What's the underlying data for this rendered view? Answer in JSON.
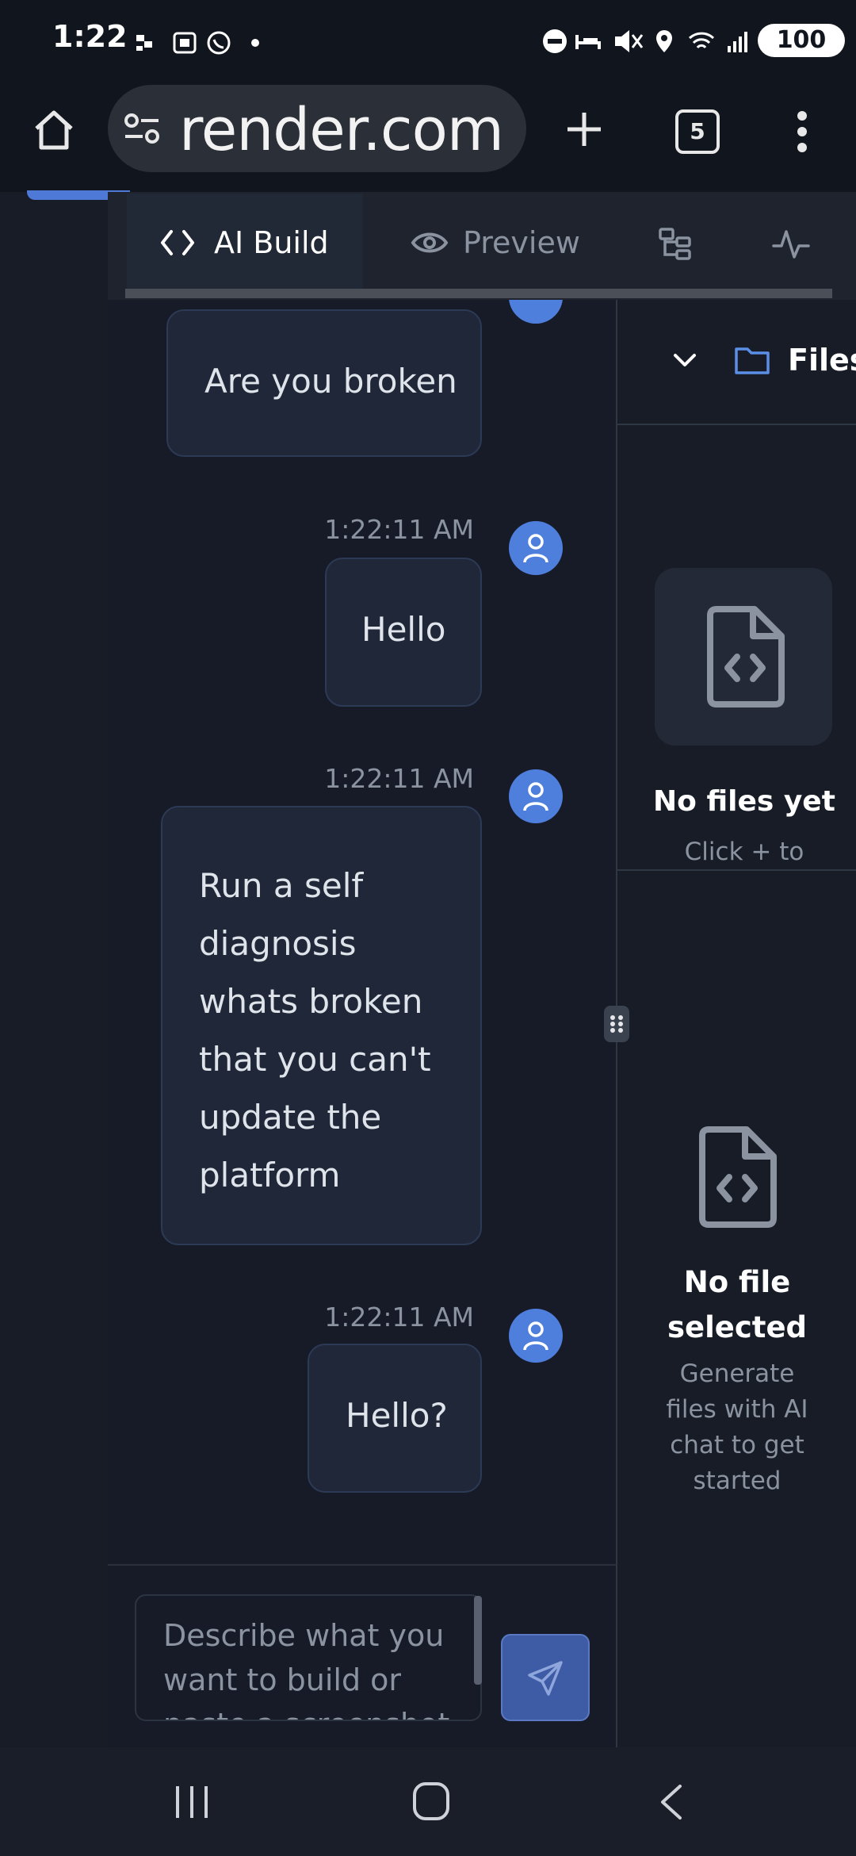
{
  "status_bar": {
    "time": "1:22",
    "battery": "100"
  },
  "browser": {
    "url": "render.com",
    "tab_count": "5"
  },
  "tabs": [
    {
      "label": "AI Build",
      "active": true
    },
    {
      "label": "Preview",
      "active": false
    }
  ],
  "messages": [
    {
      "text": "Are you broken",
      "timestamp": ""
    },
    {
      "text": "Hello",
      "timestamp": "1:22:11 AM"
    },
    {
      "text": "Run a self diagnosis whats broken that you can't update the platform",
      "timestamp": "1:22:11 AM"
    },
    {
      "text": "Hello?",
      "timestamp": "1:22:11 AM"
    }
  ],
  "files_panel": {
    "title": "Files",
    "empty_title": "No files yet",
    "empty_hint": "Click + to",
    "no_file_title": "No file selected",
    "no_file_hint": "Generate files with AI chat to get started"
  },
  "input": {
    "placeholder": "Describe what you want to build or paste a screenshot"
  },
  "colors": {
    "accent": "#4f7fdd",
    "background": "#161b27",
    "bubble": "#1f2738"
  },
  "icons": [
    "home-icon",
    "site-settings-icon",
    "new-tab-icon",
    "tabs-icon",
    "more-icon",
    "code-icon",
    "eye-icon",
    "tree-icon",
    "activity-icon",
    "user-icon",
    "chevron-down-icon",
    "folder-icon",
    "file-code-icon",
    "send-icon",
    "drag-handle-icon",
    "recents-icon",
    "home-nav-icon",
    "back-icon"
  ]
}
